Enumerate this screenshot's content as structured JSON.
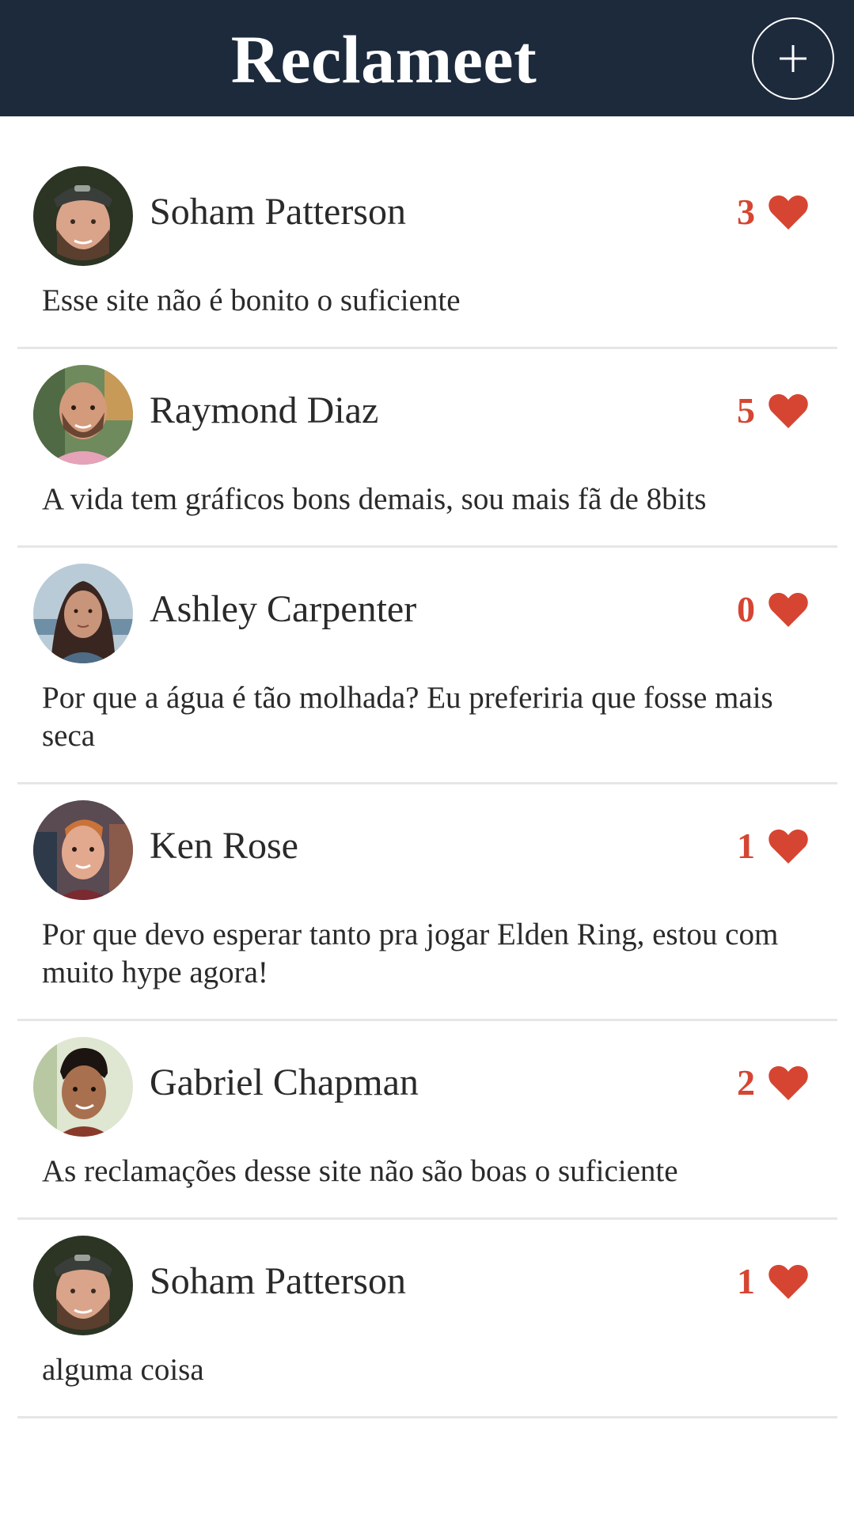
{
  "header": {
    "title": "Reclameet",
    "add_icon": "plus-icon"
  },
  "colors": {
    "header_bg": "#1c2a3c",
    "accent": "#d64532",
    "divider": "#e6e6e6"
  },
  "posts": [
    {
      "author": "Soham Patterson",
      "likes": "3",
      "text": "Esse site não é bonito o suficiente"
    },
    {
      "author": "Raymond Diaz",
      "likes": "5",
      "text": "A vida tem gráficos bons demais, sou mais fã de 8bits"
    },
    {
      "author": "Ashley Carpenter",
      "likes": "0",
      "text": "Por que a água é tão molhada? Eu preferiria que fosse mais seca"
    },
    {
      "author": "Ken Rose",
      "likes": "1",
      "text": "Por que devo esperar tanto pra jogar Elden Ring, estou com muito hype agora!"
    },
    {
      "author": "Gabriel Chapman",
      "likes": "2",
      "text": "As reclamações desse site não são boas o suficiente"
    },
    {
      "author": "Soham Patterson",
      "likes": "1",
      "text": "alguma coisa"
    }
  ]
}
